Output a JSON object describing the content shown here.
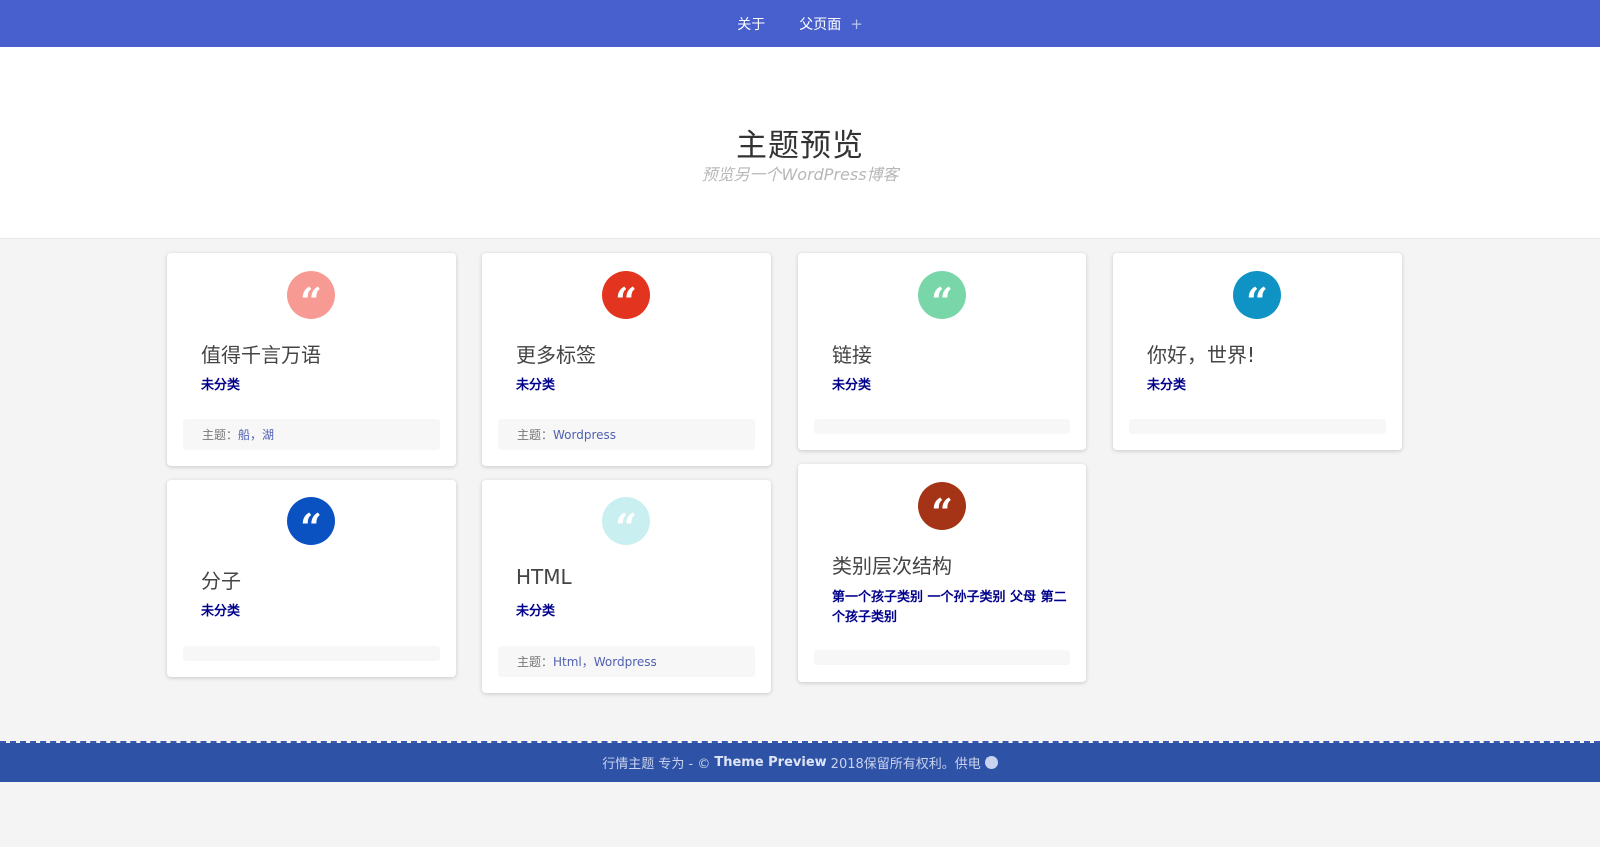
{
  "nav": {
    "about": "关于",
    "parent": "父页面",
    "expand": "+"
  },
  "site": {
    "title": "主题预览",
    "description": "预览另一个WordPress博客"
  },
  "cards": [
    {
      "quote": "“",
      "color": "#f79a94",
      "title": "值得千言万语",
      "category": "未分类",
      "tags_label": "主题：",
      "tags": "船，湖"
    },
    {
      "quote": "“",
      "color": "#e2341e",
      "title": "更多标签",
      "category": "未分类",
      "tags_label": "主题：",
      "tags": "Wordpress"
    },
    {
      "quote": "“",
      "color": "#79d6a9",
      "title": "链接",
      "category": "未分类"
    },
    {
      "quote": "“",
      "color": "#0e93c4",
      "title": "你好，世界!",
      "category": "未分类"
    },
    {
      "quote": "“",
      "color": "#0a52c2",
      "title": "分子",
      "category": "未分类"
    },
    {
      "quote": "“",
      "color": "#c9eff1",
      "title": "HTML",
      "category": "未分类",
      "tags_label": "主题：",
      "tags": "Html，Wordpress"
    },
    {
      "quote": "“",
      "color": "#a53416",
      "title": "类别层次结构",
      "category": "第一个孩子类别 一个孙子类别 父母 第二个孩子类别"
    }
  ],
  "footer": {
    "theme_text": "行情主题 专为 - ©",
    "site_name": "Theme Preview",
    "rights": "2018保留所有权利。供电",
    "wp_icon": "W"
  }
}
